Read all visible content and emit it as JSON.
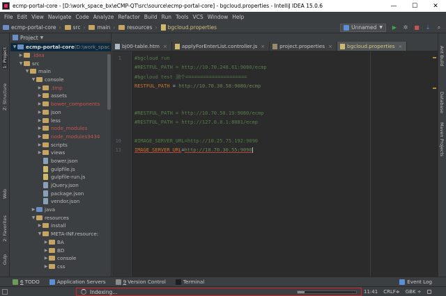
{
  "window": {
    "title": "ecmp-portal-core - [D:\\work_space_bx\\eCMP-QT\\src\\source\\ecmp-portal-core] - bgcloud.properties - IntelliJ IDEA 15.0.6",
    "minimize": "—",
    "maximize": "☐",
    "close": "✕"
  },
  "menu": [
    "File",
    "Edit",
    "View",
    "Navigate",
    "Code",
    "Analyze",
    "Refactor",
    "Build",
    "Run",
    "Tools",
    "VCS",
    "Window",
    "Help"
  ],
  "breadcrumb": [
    "ecmp-portal-core",
    "src",
    "main",
    "resources",
    "bgcloud.properties"
  ],
  "run_config": "Unnamed",
  "left_stripe": [
    "1: Project",
    "Z: Structure",
    "Web",
    "2: Favorites",
    "Gulp"
  ],
  "right_stripe": [
    "Ant Build",
    "Database",
    "Maven Projects"
  ],
  "project_panel": {
    "title": "Project",
    "tree": [
      {
        "label": "ecmp-portal-core",
        "suffix": " (D:\\work_spac",
        "depth": 0,
        "arrow": "▼",
        "icon": "module",
        "style": "bold",
        "selected": true
      },
      {
        "label": ".idea",
        "depth": 1,
        "arrow": "▶",
        "icon": "folder",
        "style": "red"
      },
      {
        "label": "src",
        "depth": 1,
        "arrow": "▼",
        "icon": "folder"
      },
      {
        "label": "main",
        "depth": 2,
        "arrow": "▼",
        "icon": "folder"
      },
      {
        "label": "console",
        "depth": 3,
        "arrow": "▼",
        "icon": "folder"
      },
      {
        "label": ".tmp",
        "depth": 4,
        "arrow": "▶",
        "icon": "folder",
        "style": "red"
      },
      {
        "label": "assets",
        "depth": 4,
        "arrow": "▶",
        "icon": "folder"
      },
      {
        "label": "bower_components",
        "depth": 4,
        "arrow": "▶",
        "icon": "folder",
        "style": "red"
      },
      {
        "label": "json",
        "depth": 4,
        "arrow": "▶",
        "icon": "folder"
      },
      {
        "label": "less",
        "depth": 4,
        "arrow": "▶",
        "icon": "folder"
      },
      {
        "label": "node_modules",
        "depth": 4,
        "arrow": "▶",
        "icon": "folder",
        "style": "red"
      },
      {
        "label": "node_modules3434",
        "depth": 4,
        "arrow": "▶",
        "icon": "folder",
        "style": "red"
      },
      {
        "label": "scripts",
        "depth": 4,
        "arrow": "▶",
        "icon": "folder"
      },
      {
        "label": "views",
        "depth": 4,
        "arrow": "▶",
        "icon": "folder"
      },
      {
        "label": "bower.json",
        "depth": 4,
        "arrow": "",
        "icon": "json"
      },
      {
        "label": "gulpfile.js",
        "depth": 4,
        "arrow": "",
        "icon": "js"
      },
      {
        "label": "gulpfile-run.js",
        "depth": 4,
        "arrow": "",
        "icon": "js"
      },
      {
        "label": "jQuery.json",
        "depth": 4,
        "arrow": "",
        "icon": "json"
      },
      {
        "label": "package.json",
        "depth": 4,
        "arrow": "",
        "icon": "json"
      },
      {
        "label": "vendor.json",
        "depth": 4,
        "arrow": "",
        "icon": "json"
      },
      {
        "label": "java",
        "depth": 3,
        "arrow": "▶",
        "icon": "module"
      },
      {
        "label": "resources",
        "depth": 3,
        "arrow": "▼",
        "icon": "folder"
      },
      {
        "label": "install",
        "depth": 4,
        "arrow": "▶",
        "icon": "folder"
      },
      {
        "label": "META-INF.resource:",
        "depth": 4,
        "arrow": "▼",
        "icon": "folder"
      },
      {
        "label": "BA",
        "depth": 5,
        "arrow": "▶",
        "icon": "folder"
      },
      {
        "label": "BD",
        "depth": 5,
        "arrow": "▶",
        "icon": "folder"
      },
      {
        "label": "console",
        "depth": 5,
        "arrow": "▶",
        "icon": "folder"
      },
      {
        "label": "css",
        "depth": 5,
        "arrow": "▶",
        "icon": "folder"
      }
    ]
  },
  "editor_tabs": [
    {
      "label": "bj00-table.htm",
      "icon": "html"
    },
    {
      "label": "applyForEnterList.controller.js",
      "icon": "js"
    },
    {
      "label": "project.properties",
      "icon": "prop"
    },
    {
      "label": "bgcloud.properties",
      "icon": "prop",
      "active": true
    }
  ],
  "code_lines": [
    {
      "num": "1",
      "segments": [
        {
          "t": "#bgcloud run",
          "c": "comment"
        }
      ]
    },
    {
      "num": "",
      "segments": [
        {
          "t": "#RESTFUL_PATH = http://10.70.248.61:9080/ecmp",
          "c": "comment"
        }
      ]
    },
    {
      "num": "",
      "segments": [
        {
          "t": "#bgcloud test 测个=====================",
          "c": "comment"
        }
      ]
    },
    {
      "num": "",
      "segments": [
        {
          "t": "RESTFUL_PATH",
          "c": "key"
        },
        {
          "t": " = ",
          "c": "eq"
        },
        {
          "t": "http://10.70.30.58:9080/ecmp",
          "c": "val"
        }
      ]
    },
    {
      "num": "",
      "segments": []
    },
    {
      "num": "",
      "segments": []
    },
    {
      "num": "",
      "segments": [
        {
          "t": "#RESTFUL_PATH = http://10.70.50.19:9080/ecmp",
          "c": "comment"
        }
      ]
    },
    {
      "num": "",
      "segments": [
        {
          "t": "#RESTFUL_PATH = http://127.0.0.1:8081/ecmp",
          "c": "comment"
        }
      ]
    },
    {
      "num": "",
      "segments": []
    },
    {
      "num": "10",
      "segments": [
        {
          "t": "#IMAGE_SERVER_URL=http://10.25.75.192:9090",
          "c": "comment"
        }
      ]
    },
    {
      "num": "11",
      "segments": [
        {
          "t": "IMAGE_SERVER_URL",
          "c": "key-u"
        },
        {
          "t": "=",
          "c": "eq"
        },
        {
          "t": "http://10.70.30.55:9090",
          "c": "val-u"
        }
      ]
    }
  ],
  "bottom_tools": [
    {
      "num": "6",
      "label": "TODO",
      "icon_color": "#6e9b5a"
    },
    {
      "num": "",
      "label": "Application Servers",
      "icon_color": "#5c8fd6"
    },
    {
      "num": "9",
      "label": "Version Control",
      "icon_color": "#8a8a8a"
    },
    {
      "num": "",
      "label": "Terminal",
      "icon_color": "#1e1e1e"
    }
  ],
  "event_log": "Event Log",
  "status": {
    "text": "Indexing...",
    "progress": 0.12,
    "position": "11:41",
    "line_sep": "CRLF≑",
    "encoding": "GBK ÷"
  },
  "colors": {
    "accent_red": "#d9222a",
    "editor_bg": "#2b2b2b",
    "key": "#cc7832",
    "value": "#6a8759"
  }
}
